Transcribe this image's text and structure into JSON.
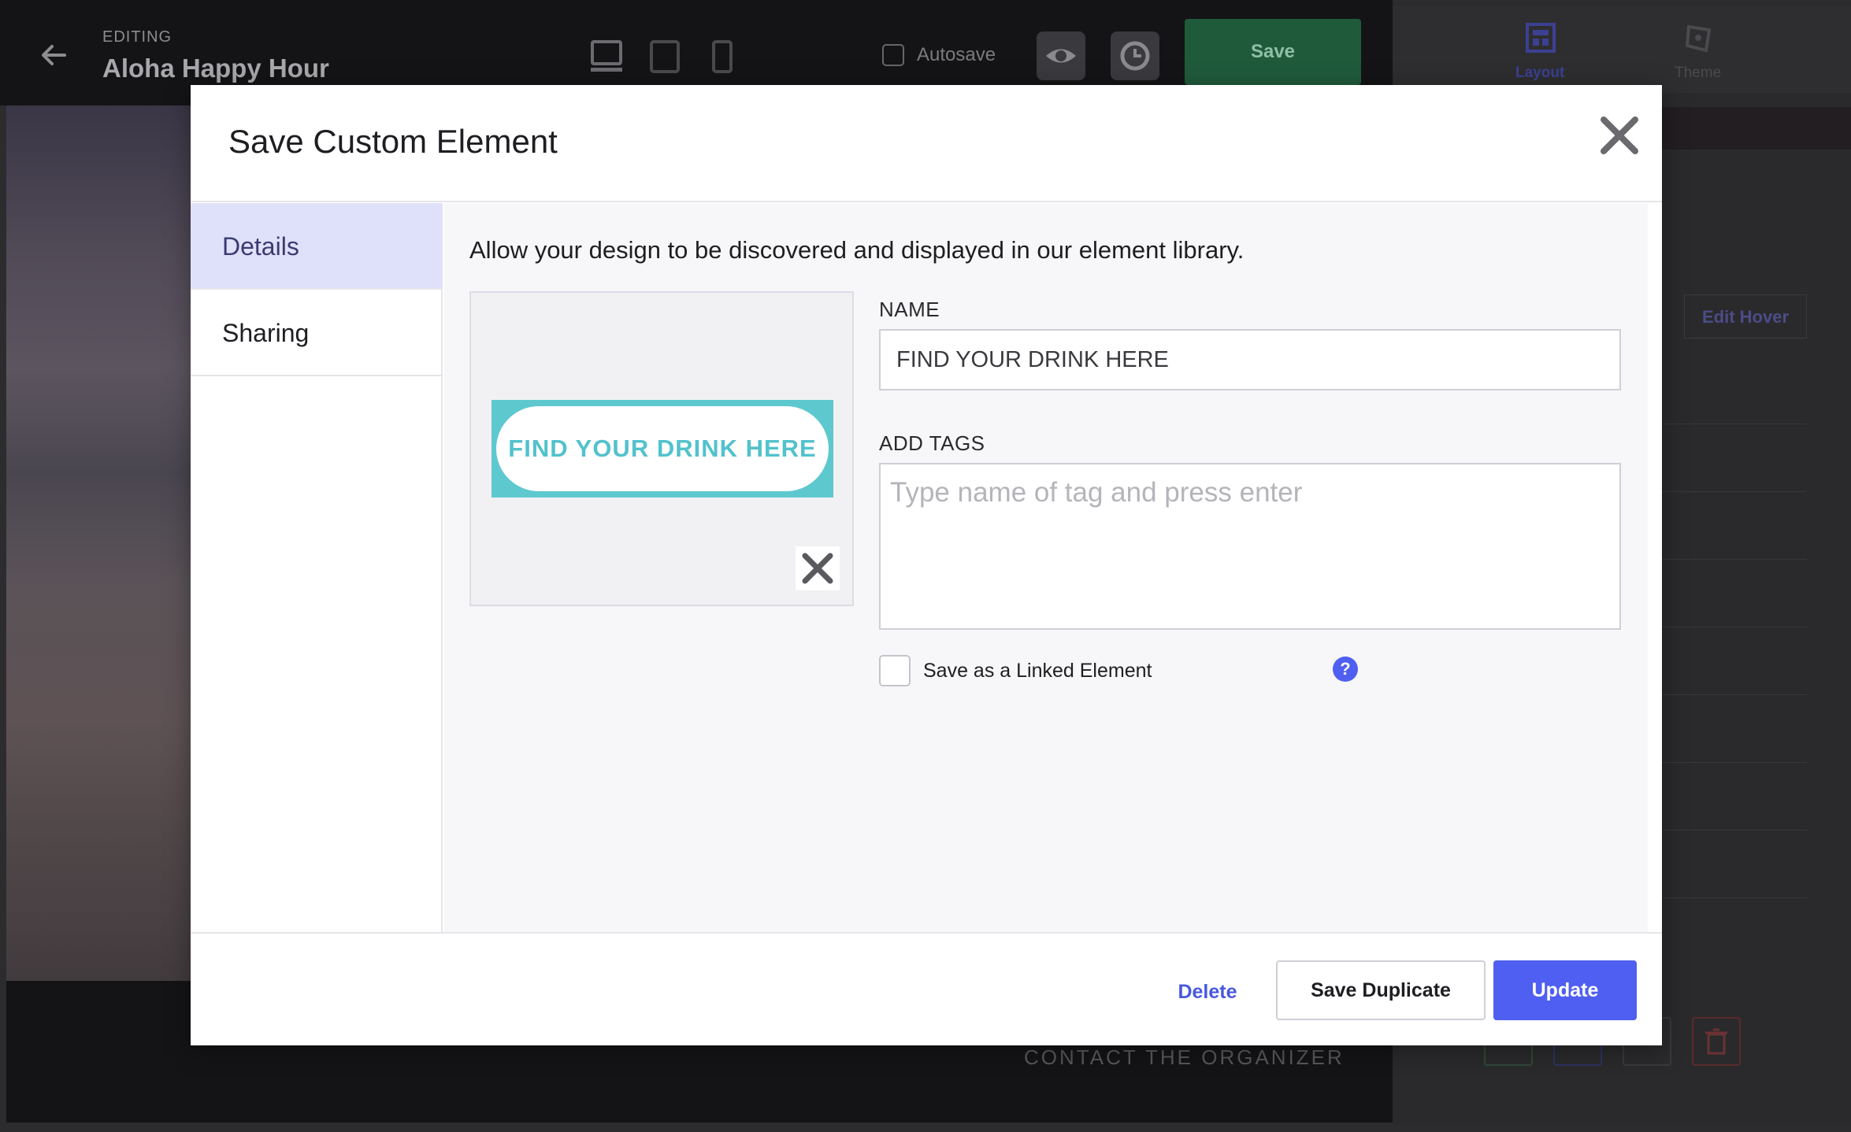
{
  "editor": {
    "editing_label": "EDITING",
    "site_title": "Aloha Happy Hour",
    "autosave_label": "Autosave",
    "save_label": "Save",
    "tabs": [
      {
        "label": "Layout",
        "icon": "layout-icon"
      },
      {
        "label": "Theme",
        "icon": "theme-icon"
      }
    ],
    "edit_hover_label": "Edit Hover",
    "contact_label": "CONTACT THE ORGANIZER"
  },
  "modal": {
    "title": "Save Custom Element",
    "nav": [
      {
        "label": "Details",
        "active": true
      },
      {
        "label": "Sharing",
        "active": false
      }
    ],
    "intro": "Allow your design to be discovered and displayed in our element library.",
    "preview_text": "FIND YOUR DRINK HERE",
    "name_label": "NAME",
    "name_value": "FIND YOUR DRINK HERE",
    "tags_label": "ADD TAGS",
    "tags_placeholder": "Type name of tag and press enter",
    "linked_label": "Save as a Linked Element",
    "linked_checked": false,
    "help_glyph": "?",
    "buttons": {
      "delete": "Delete",
      "save_duplicate": "Save Duplicate",
      "update": "Update"
    }
  },
  "colors": {
    "accent": "#4f5ff1",
    "active_nav_bg": "#dfe1fb",
    "preview_teal": "#5ec8cf",
    "save_green": "#1f5a3b"
  }
}
